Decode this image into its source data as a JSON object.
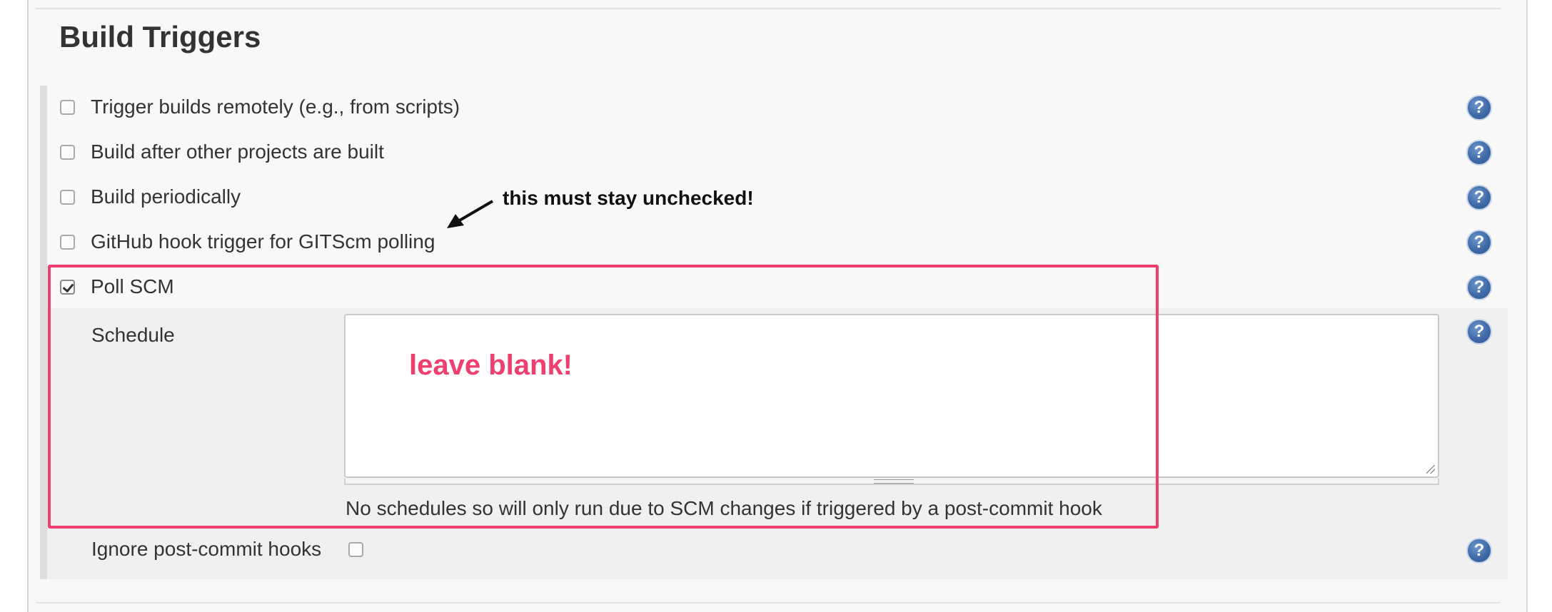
{
  "section": {
    "title": "Build Triggers"
  },
  "triggers": [
    {
      "label": "Trigger builds remotely (e.g., from scripts)",
      "checked": false
    },
    {
      "label": "Build after other projects are built",
      "checked": false
    },
    {
      "label": "Build periodically",
      "checked": false
    },
    {
      "label": "GitHub hook trigger for GITScm polling",
      "checked": false
    },
    {
      "label": "Poll SCM",
      "checked": true
    }
  ],
  "poll_scm": {
    "schedule_label": "Schedule",
    "schedule_value": "",
    "hint": "No schedules so will only run due to SCM changes if triggered by a post-commit hook",
    "ignore_label": "Ignore post-commit hooks",
    "ignore_checked": false
  },
  "help_icon": {
    "glyph": "?"
  },
  "annotations": {
    "arrow_note": "this must stay unchecked!",
    "textarea_note": "leave blank!"
  },
  "colors": {
    "annotation": "#ee3f6e",
    "help_icon": "#3f6aa8"
  }
}
